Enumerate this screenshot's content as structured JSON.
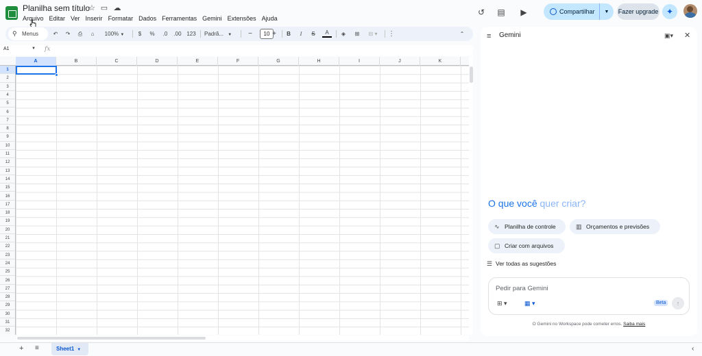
{
  "header": {
    "doc_title": "Planilha sem título",
    "menus": [
      "Arquivo",
      "Editar",
      "Ver",
      "Inserir",
      "Formatar",
      "Dados",
      "Ferramentas",
      "Gemini",
      "Extensões",
      "Ajuda"
    ],
    "share_label": "Compartilhar",
    "upgrade_label": "Fazer upgrade"
  },
  "toolbar": {
    "search_label": "Menus",
    "zoom": "100%",
    "currency": "$",
    "percent": "%",
    "dec_decrease": ".0",
    "dec_increase": ".00",
    "number_format": "123",
    "font": "Padrã...",
    "font_size": "10",
    "bold": "B",
    "italic": "I",
    "strike": "S",
    "text_color": "A"
  },
  "formula_bar": {
    "cell_ref": "A1",
    "fx": "fx"
  },
  "grid": {
    "columns": [
      "A",
      "B",
      "C",
      "D",
      "E",
      "F",
      "G",
      "H",
      "I",
      "J",
      "K"
    ],
    "rows": [
      "1",
      "2",
      "3",
      "4",
      "5",
      "6",
      "7",
      "8",
      "9",
      "10",
      "11",
      "12",
      "13",
      "14",
      "15",
      "16",
      "17",
      "18",
      "19",
      "20",
      "21",
      "22",
      "23",
      "24",
      "25",
      "26",
      "27",
      "28",
      "29",
      "30",
      "31",
      "32"
    ]
  },
  "sheets": {
    "active": "Sheet1"
  },
  "gemini": {
    "title": "Gemini",
    "headline_a": "O que você ",
    "headline_b": "quer criar?",
    "chips": [
      "Planilha de controle",
      "Orçamentos e previsões",
      "Criar com arquivos"
    ],
    "see_all": "Ver todas as sugestões",
    "input_placeholder": "Pedir para Gemini",
    "beta": "Beta",
    "disclaimer": "O Gemini no Workspace pode cometer erros.",
    "disclaimer_link": "Saiba mais"
  },
  "colors": {
    "accent": "#1a73e8",
    "share_bg": "#c2e7ff",
    "sheet_green": "#1e8e3e"
  }
}
